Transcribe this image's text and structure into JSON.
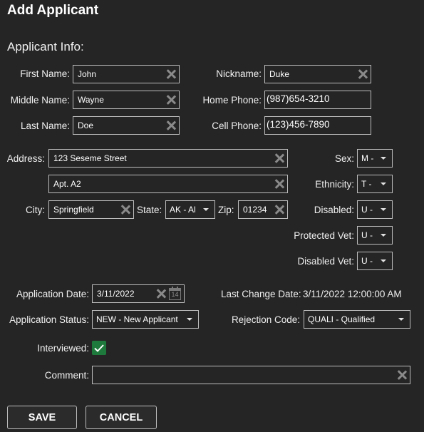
{
  "header": {
    "title": "Add Applicant"
  },
  "section": {
    "title": "Applicant Info:"
  },
  "fields": {
    "first_name": {
      "label": "First Name:",
      "value": "John"
    },
    "middle_name": {
      "label": "Middle Name:",
      "value": "Wayne"
    },
    "last_name": {
      "label": "Last Name:",
      "value": "Doe"
    },
    "nickname": {
      "label": "Nickname:",
      "value": "Duke"
    },
    "home_phone": {
      "label": "Home Phone:",
      "value": "(987)654-3210"
    },
    "cell_phone": {
      "label": "Cell Phone:",
      "value": "(123)456-7890"
    },
    "address": {
      "label": "Address:",
      "line1": "123 Seseme Street",
      "line2": "Apt. A2"
    },
    "city": {
      "label": "City:",
      "value": "Springfield"
    },
    "state": {
      "label": "State:",
      "value": "AK - Al"
    },
    "zip": {
      "label": "Zip:",
      "value": "01234"
    },
    "sex": {
      "label": "Sex:",
      "value": "M -"
    },
    "ethnicity": {
      "label": "Ethnicity:",
      "value": "T -"
    },
    "disabled": {
      "label": "Disabled:",
      "value": "U -"
    },
    "protected_vet": {
      "label": "Protected Vet:",
      "value": "U -"
    },
    "disabled_vet": {
      "label": "Disabled Vet:",
      "value": "U -"
    },
    "application_date": {
      "label": "Application Date:",
      "value": "3/11/2022",
      "calendar_day": "14"
    },
    "last_change_date": {
      "label": "Last Change Date:",
      "value": "3/11/2022 12:00:00 AM"
    },
    "application_status": {
      "label": "Application Status:",
      "value": "NEW - New Applicant"
    },
    "rejection_code": {
      "label": "Rejection Code:",
      "value": "QUALI - Qualified"
    },
    "interviewed": {
      "label": "Interviewed:",
      "checked": true
    },
    "comment": {
      "label": "Comment:",
      "value": ""
    }
  },
  "buttons": {
    "save": "SAVE",
    "cancel": "CANCEL"
  },
  "colors": {
    "background": "#252525",
    "checkbox": "#1e7a3c",
    "border": "#bdbdbd"
  }
}
